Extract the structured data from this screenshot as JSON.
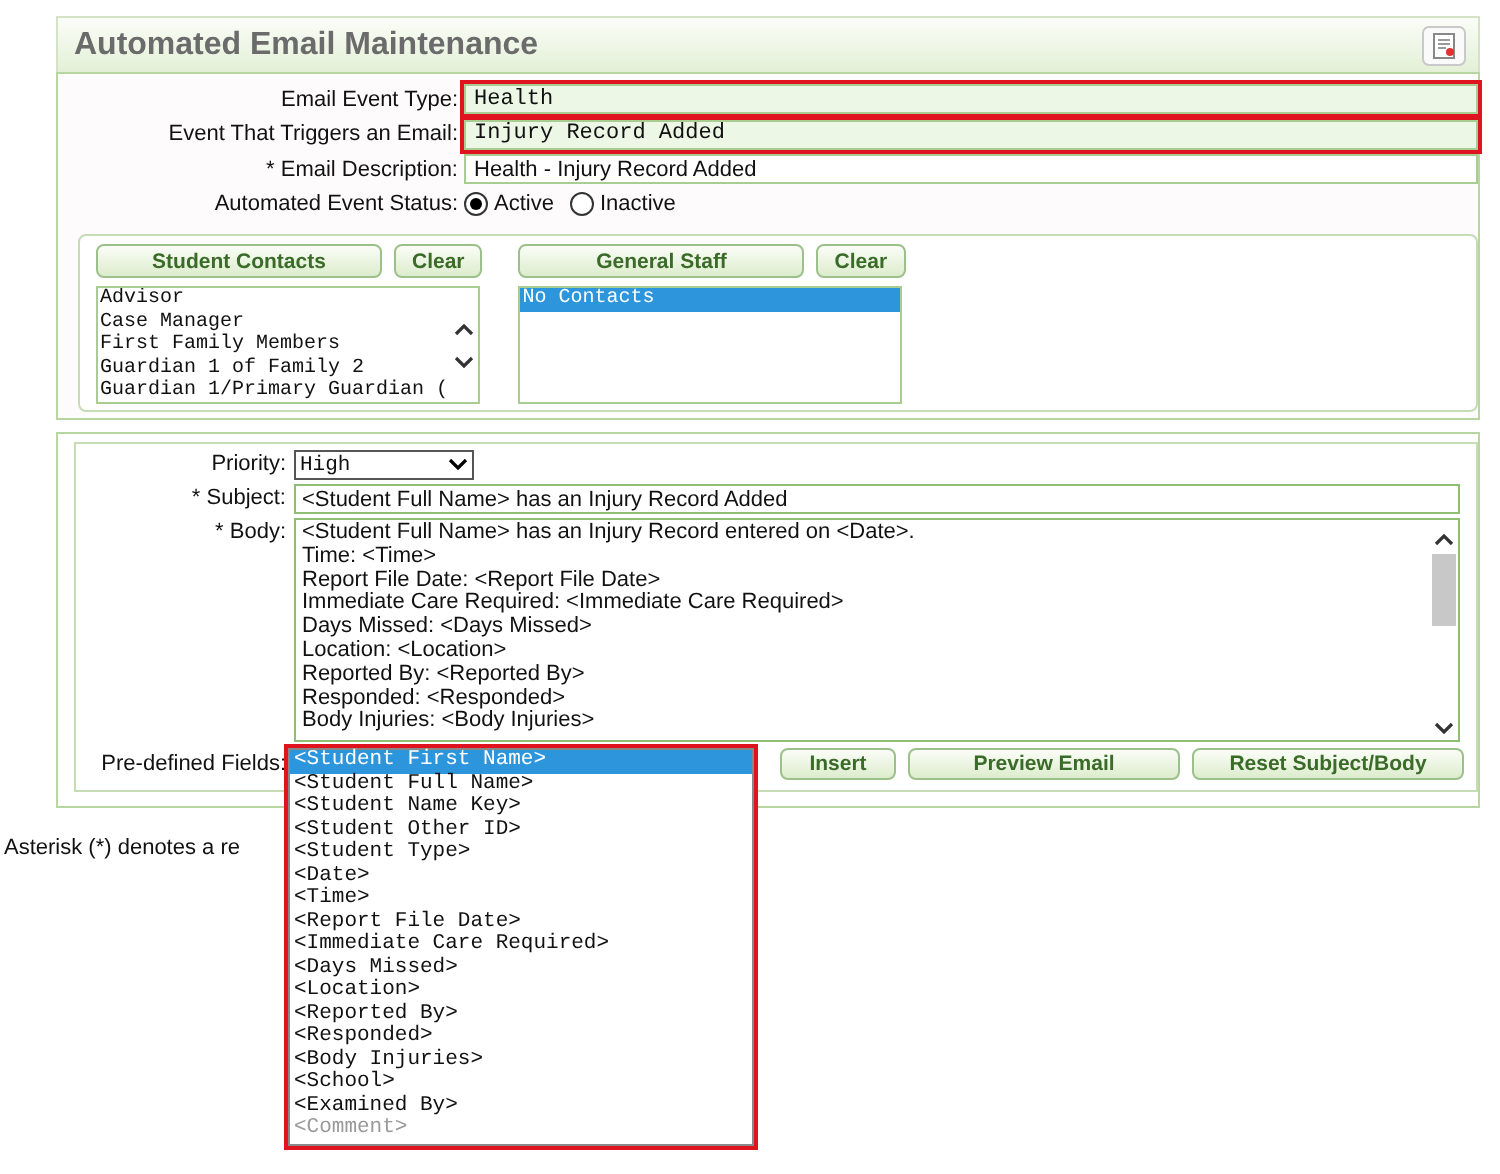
{
  "window": {
    "title": "Automated Email Maintenance"
  },
  "event_fields": [
    {
      "label": "Email Event Type:",
      "value": "Health",
      "kind": "readonly",
      "highlighted": true
    },
    {
      "label": "Event That Triggers an Email:",
      "value": "Injury Record Added",
      "kind": "readonly",
      "highlighted": true
    },
    {
      "label": "* Email Description:",
      "value": "Health - Injury Record Added",
      "kind": "input",
      "highlighted": false
    }
  ],
  "status": {
    "label": "Automated Event Status:",
    "options": [
      {
        "label": "Active",
        "selected": true
      },
      {
        "label": "Inactive",
        "selected": false
      }
    ]
  },
  "contact_groups": [
    {
      "button": "Student Contacts",
      "clear": "Clear",
      "items": [
        {
          "label": "Advisor",
          "selected": false
        },
        {
          "label": "Case Manager",
          "selected": false
        },
        {
          "label": "First Family Members",
          "selected": false
        },
        {
          "label": "Guardian 1 of Family 2",
          "selected": false
        },
        {
          "label": "Guardian 1/Primary Guardian (",
          "selected": false
        }
      ],
      "scrollable": true
    },
    {
      "button": "General Staff",
      "clear": "Clear",
      "items": [
        {
          "label": "No Contacts",
          "selected": true
        }
      ],
      "scrollable": false
    }
  ],
  "priority": {
    "label": "Priority:",
    "value": "High"
  },
  "subject": {
    "label": "* Subject:",
    "value": "<Student Full Name> has an Injury Record Added"
  },
  "body": {
    "label": "* Body:",
    "lines": [
      "<Student Full Name> has an Injury Record entered on <Date>.",
      "Time: <Time>",
      "Report File Date: <Report File Date>",
      "Immediate Care Required: <Immediate Care Required>",
      "Days Missed: <Days Missed>",
      "Location: <Location>",
      "Reported By: <Reported By>",
      "Responded: <Responded>",
      "Body Injuries: <Body Injuries>"
    ]
  },
  "predefined": {
    "label": "Pre-defined Fields:",
    "highlighted": true,
    "options": [
      {
        "label": "<Student First Name>",
        "selected": true,
        "disabled": false
      },
      {
        "label": "<Student Full Name>",
        "selected": false,
        "disabled": false
      },
      {
        "label": "<Student Name Key>",
        "selected": false,
        "disabled": false
      },
      {
        "label": "<Student Other ID>",
        "selected": false,
        "disabled": false
      },
      {
        "label": "<Student Type>",
        "selected": false,
        "disabled": false
      },
      {
        "label": "<Date>",
        "selected": false,
        "disabled": false
      },
      {
        "label": "<Time>",
        "selected": false,
        "disabled": false
      },
      {
        "label": "<Report File Date>",
        "selected": false,
        "disabled": false
      },
      {
        "label": "<Immediate Care Required>",
        "selected": false,
        "disabled": false
      },
      {
        "label": "<Days Missed>",
        "selected": false,
        "disabled": false
      },
      {
        "label": "<Location>",
        "selected": false,
        "disabled": false
      },
      {
        "label": "<Reported By>",
        "selected": false,
        "disabled": false
      },
      {
        "label": "<Responded>",
        "selected": false,
        "disabled": false
      },
      {
        "label": "<Body Injuries>",
        "selected": false,
        "disabled": false
      },
      {
        "label": "<School>",
        "selected": false,
        "disabled": false
      },
      {
        "label": "<Examined By>",
        "selected": false,
        "disabled": false
      },
      {
        "label": "<Comment>",
        "selected": false,
        "disabled": true
      }
    ]
  },
  "buttons": [
    "Insert",
    "Preview Email",
    "Reset Subject/Body"
  ],
  "footnote": "Asterisk (*) denotes a re"
}
